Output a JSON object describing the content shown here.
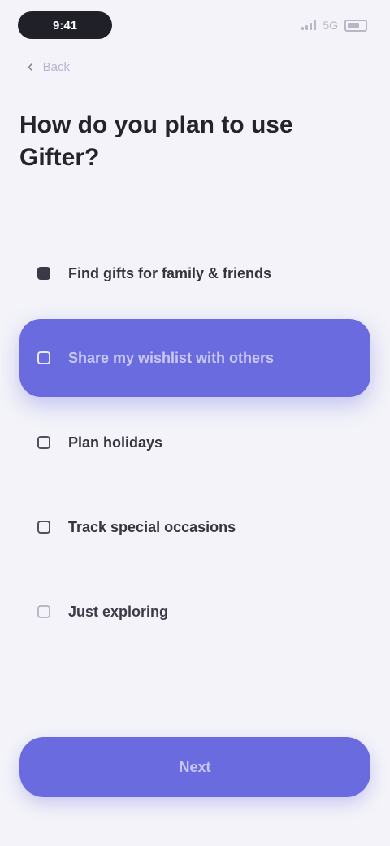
{
  "status_bar": {
    "time": "9:41",
    "network": "5G"
  },
  "header": {
    "back_label": "Back"
  },
  "question": {
    "title": "How do you plan to use Gifter?"
  },
  "options": [
    {
      "label": "Find gifts for family & friends",
      "state": "filled"
    },
    {
      "label": "Share my wishlist with others",
      "state": "selected"
    },
    {
      "label": "Plan holidays",
      "state": "default"
    },
    {
      "label": "Track special occasions",
      "state": "default"
    },
    {
      "label": "Just exploring",
      "state": "muted"
    }
  ],
  "footer": {
    "next_label": "Next"
  },
  "colors": {
    "accent": "#6b6be0",
    "background": "#f3f3f9",
    "text": "#24242c"
  }
}
